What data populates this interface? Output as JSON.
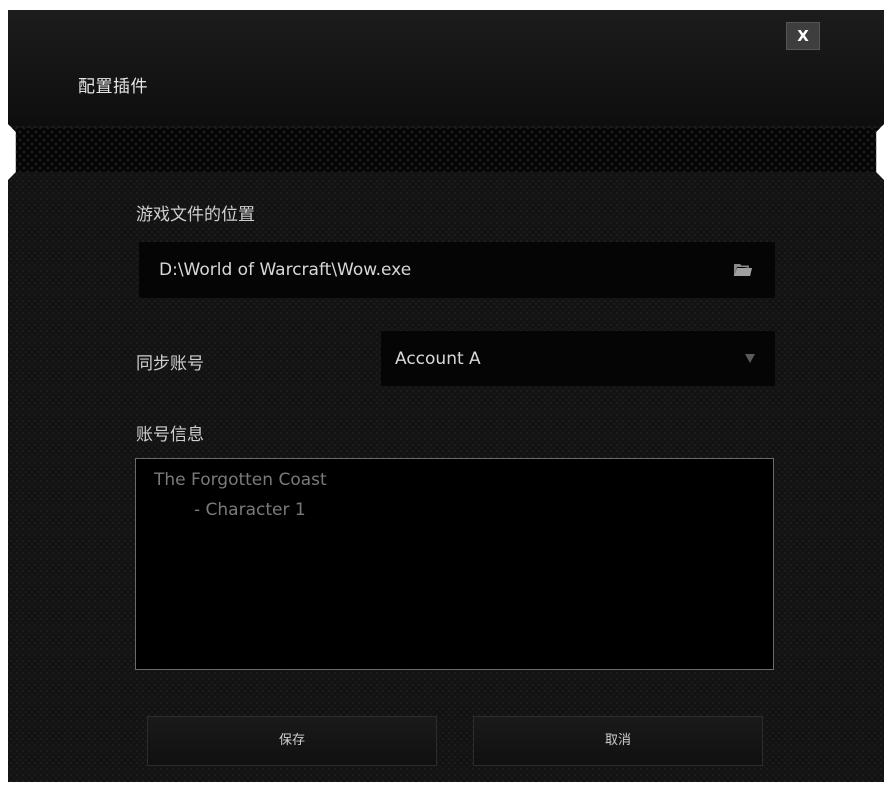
{
  "dialog": {
    "title": "配置插件",
    "close_label": "X"
  },
  "game_location": {
    "label": "游戏文件的位置",
    "value": "D:\\World of Warcraft\\Wow.exe",
    "browse_icon": "folder-open-icon"
  },
  "sync_account": {
    "label": "同步账号",
    "selected": "Account A"
  },
  "account_info": {
    "label": "账号信息",
    "lines": [
      "The Forgotten Coast",
      "- Character 1"
    ]
  },
  "buttons": {
    "save_label": "保存",
    "cancel_label": "取消"
  },
  "colors": {
    "background": "#121212",
    "field": "#050505",
    "text": "#d8d8d8",
    "muted_text": "#7a7a7a"
  }
}
